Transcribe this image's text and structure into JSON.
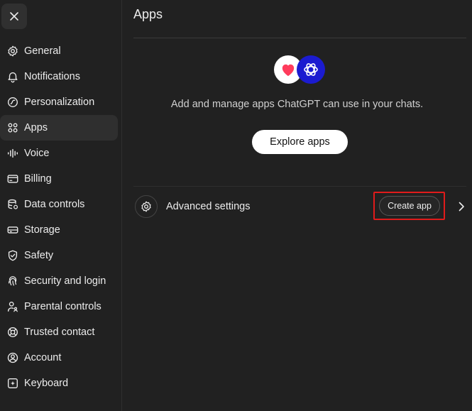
{
  "sidebar": {
    "close_icon": "close-icon",
    "items": [
      {
        "label": "General",
        "icon": "gear-icon"
      },
      {
        "label": "Notifications",
        "icon": "bell-icon"
      },
      {
        "label": "Personalization",
        "icon": "personalization-icon"
      },
      {
        "label": "Apps",
        "icon": "apps-grid-icon",
        "active": true
      },
      {
        "label": "Voice",
        "icon": "waveform-icon"
      },
      {
        "label": "Billing",
        "icon": "credit-card-icon"
      },
      {
        "label": "Data controls",
        "icon": "database-icon"
      },
      {
        "label": "Storage",
        "icon": "storage-icon"
      },
      {
        "label": "Safety",
        "icon": "shield-icon"
      },
      {
        "label": "Security and login",
        "icon": "fingerprint-icon"
      },
      {
        "label": "Parental controls",
        "icon": "parental-icon"
      },
      {
        "label": "Trusted contact",
        "icon": "lifebuoy-icon"
      },
      {
        "label": "Account",
        "icon": "account-icon"
      },
      {
        "label": "Keyboard",
        "icon": "keyboard-icon"
      }
    ]
  },
  "main": {
    "title": "Apps",
    "hero_text": "Add and manage apps ChatGPT can use in your chats.",
    "explore_label": "Explore apps",
    "advanced_label": "Advanced settings",
    "create_label": "Create app"
  },
  "colors": {
    "background": "#212121",
    "text": "#ececec",
    "highlight": "#e01b1b",
    "heart": "#ff3b5c",
    "gpt_badge": "#1b1bd0"
  }
}
